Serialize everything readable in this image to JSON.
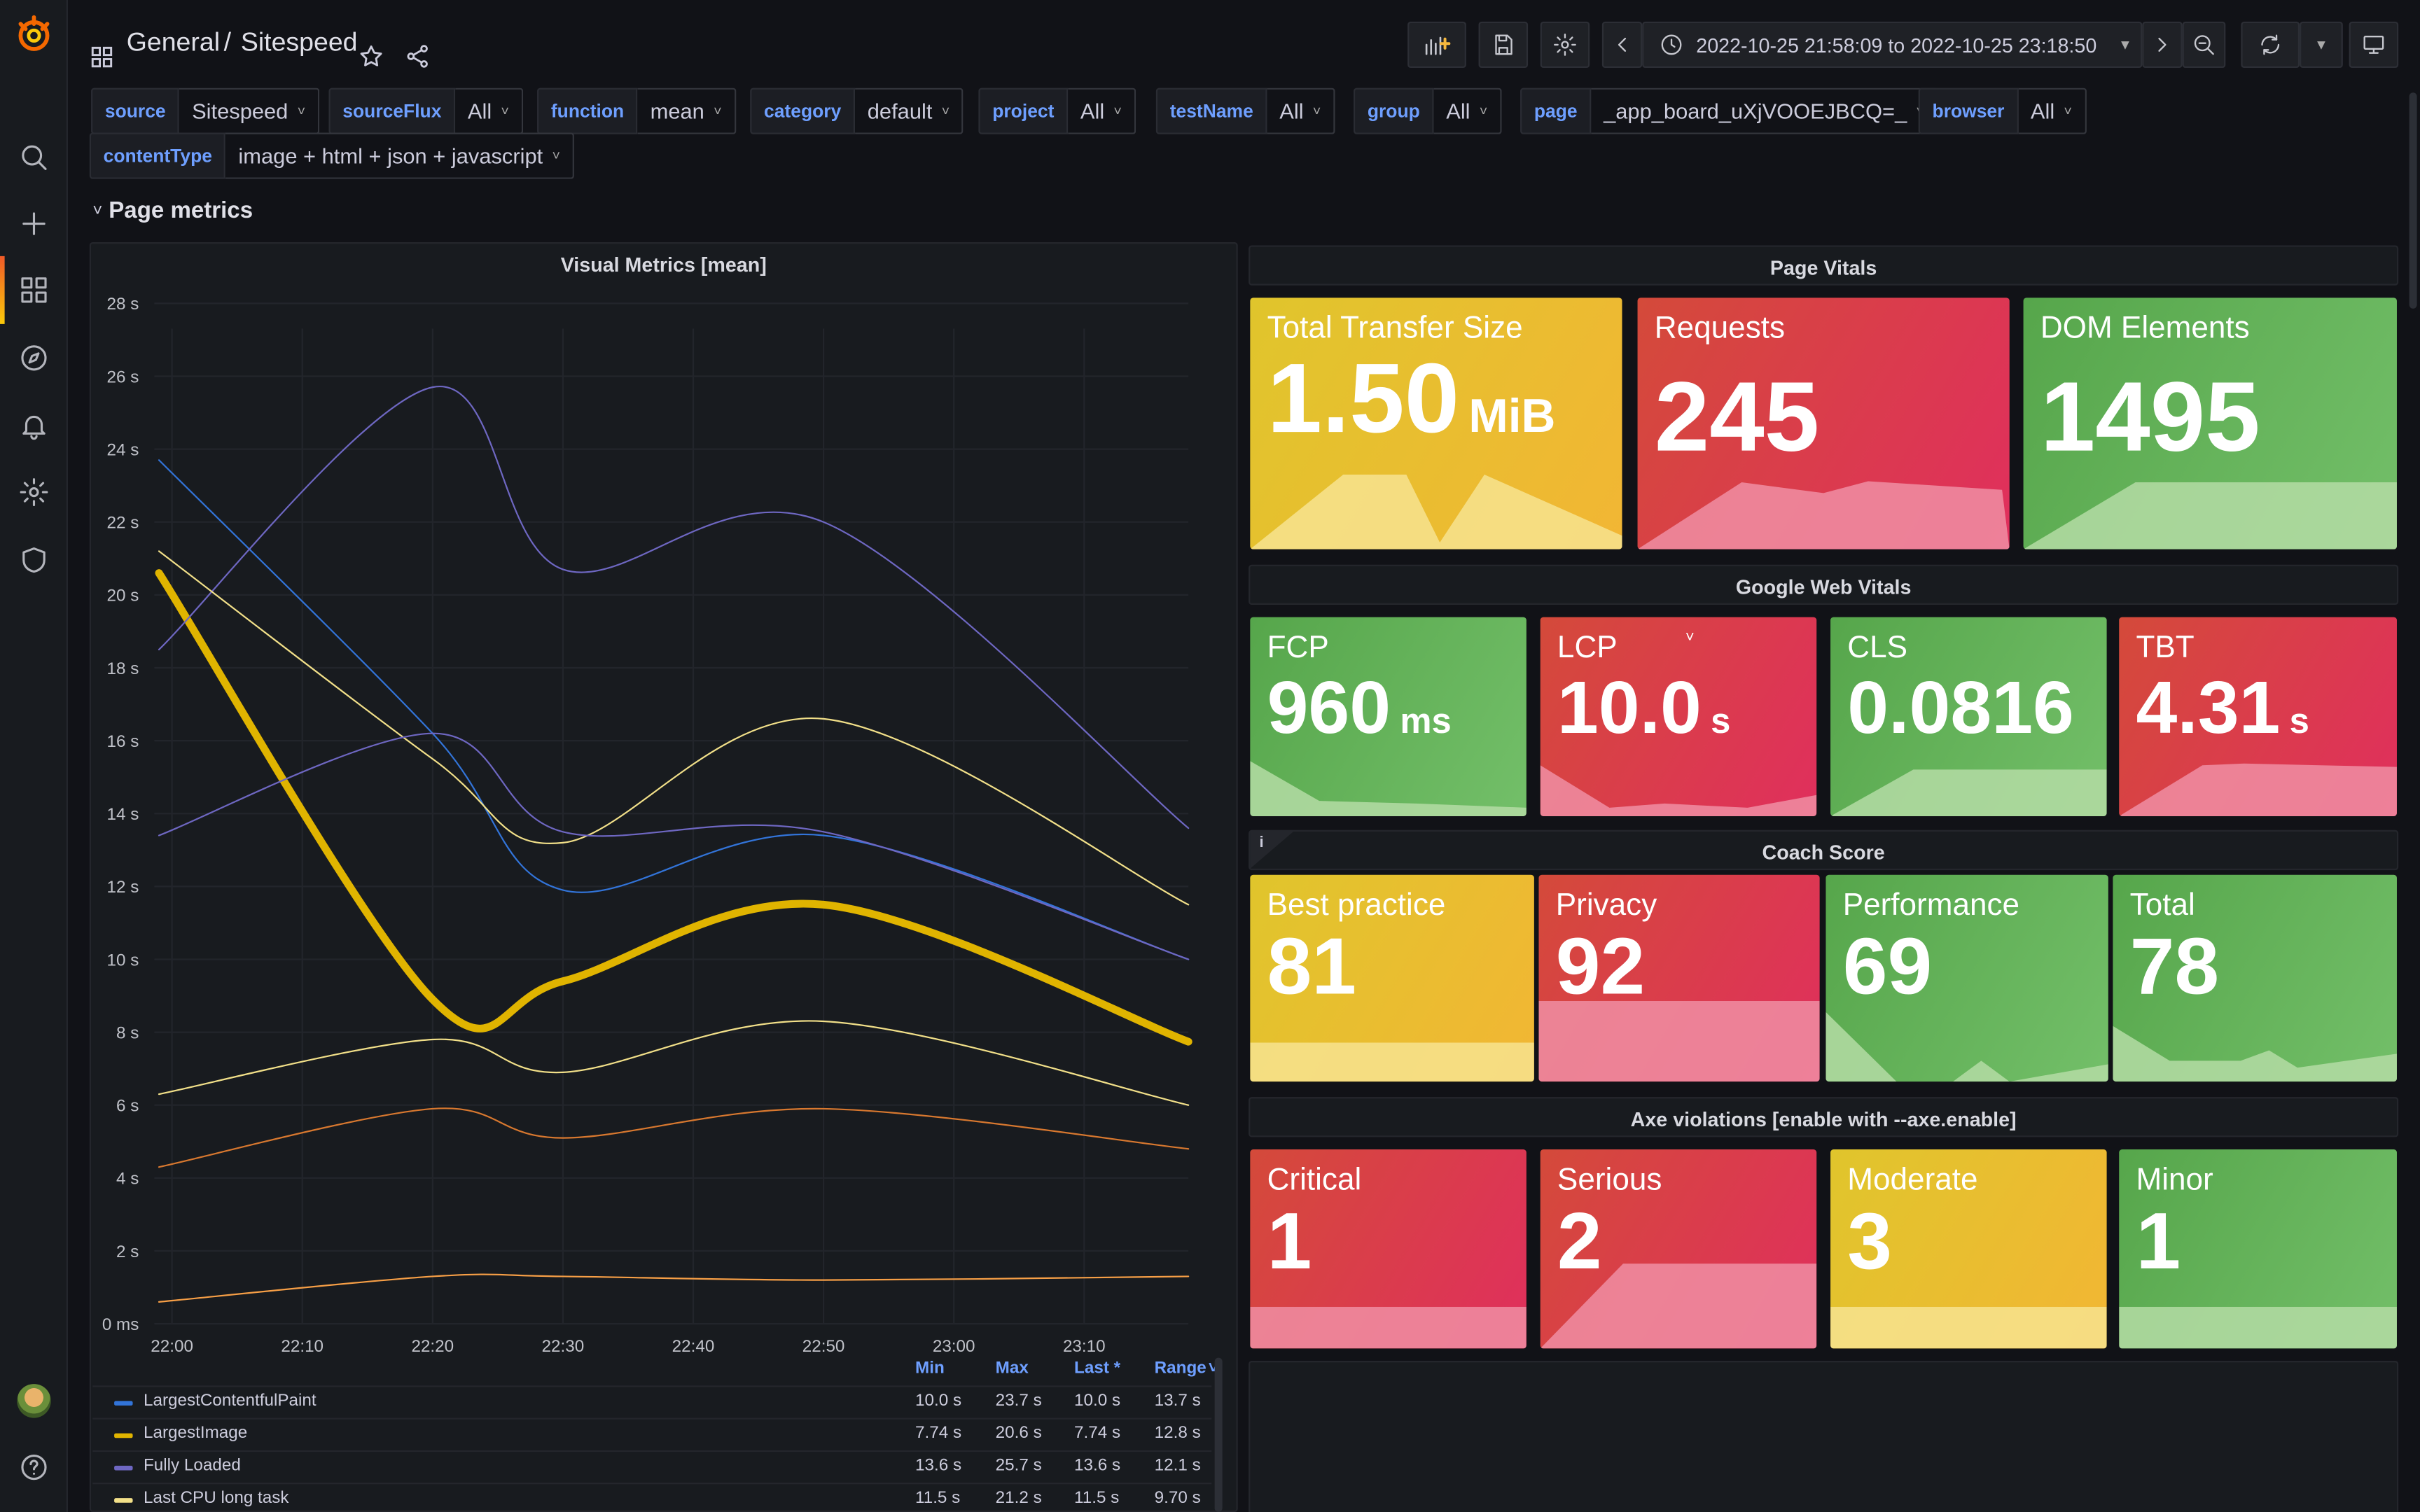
{
  "breadcrumb": {
    "folder": "General",
    "separator": "/",
    "dashboard": "Sitespeed"
  },
  "timepicker": {
    "range": "2022-10-25 21:58:09 to 2022-10-25 23:18:50"
  },
  "variables": [
    {
      "label": "source",
      "value": "Sitespeed"
    },
    {
      "label": "sourceFlux",
      "value": "All"
    },
    {
      "label": "function",
      "value": "mean"
    },
    {
      "label": "category",
      "value": "default"
    },
    {
      "label": "project",
      "value": "All"
    },
    {
      "label": "testName",
      "value": "All"
    },
    {
      "label": "group",
      "value": "All"
    },
    {
      "label": "page",
      "value": "_app_board_uXjVOOEJBCQ=_"
    },
    {
      "label": "browser",
      "value": "All"
    },
    {
      "label": "contentType",
      "value": "image + html + json + javascript"
    }
  ],
  "row": {
    "title": "Page metrics",
    "chevron": "˅"
  },
  "vitals_header": "Page Vitals",
  "page_vitals": [
    {
      "label": "Total Transfer Size",
      "value": "1.50",
      "unit": "MiB",
      "color": "yellow"
    },
    {
      "label": "Requests",
      "value": "245",
      "unit": "",
      "color": "red"
    },
    {
      "label": "DOM Elements",
      "value": "1495",
      "unit": "",
      "color": "green"
    }
  ],
  "web_vitals_header": "Google Web Vitals",
  "web_vitals": [
    {
      "label": "FCP",
      "value": "960",
      "unit": "ms",
      "color": "green"
    },
    {
      "label": "LCP",
      "value": "10.0",
      "unit": "s",
      "color": "red"
    },
    {
      "label": "CLS",
      "value": "0.0816",
      "unit": "",
      "color": "green"
    },
    {
      "label": "TBT",
      "value": "4.31",
      "unit": "s",
      "color": "red"
    }
  ],
  "coach_header": "Coach Score",
  "coach_info": "i",
  "coach": [
    {
      "label": "Best practice",
      "value": "81",
      "color": "yellow"
    },
    {
      "label": "Privacy",
      "value": "92",
      "color": "red"
    },
    {
      "label": "Performance",
      "value": "69",
      "color": "green"
    },
    {
      "label": "Total",
      "value": "78",
      "color": "green"
    }
  ],
  "axe_header": "Axe violations [enable with --axe.enable]",
  "axe": [
    {
      "label": "Critical",
      "value": "1",
      "color": "red"
    },
    {
      "label": "Serious",
      "value": "2",
      "color": "red"
    },
    {
      "label": "Moderate",
      "value": "3",
      "color": "yellow"
    },
    {
      "label": "Minor",
      "value": "1",
      "color": "green"
    }
  ],
  "legend": {
    "headers": {
      "min": "Min",
      "max": "Max",
      "last": "Last *",
      "range": "Range"
    },
    "rows": [
      {
        "name": "LargestContentfulPaint",
        "min": "10.0 s",
        "max": "23.7 s",
        "last": "10.0 s",
        "range": "13.7 s"
      },
      {
        "name": "LargestImage",
        "min": "7.74 s",
        "max": "20.6 s",
        "last": "7.74 s",
        "range": "12.8 s"
      },
      {
        "name": "Fully Loaded",
        "min": "13.6 s",
        "max": "25.7 s",
        "last": "13.6 s",
        "range": "12.1 s"
      },
      {
        "name": "Last CPU long task",
        "min": "11.5 s",
        "max": "21.2 s",
        "last": "11.5 s",
        "range": "9.70 s"
      }
    ]
  },
  "colors": {
    "blue": "#3274d9",
    "yellow": "#e0b400",
    "purple": "#6e67c2",
    "lightyellow": "#f2e089",
    "orange": "#d8782f"
  },
  "chart_data": {
    "type": "line",
    "title": "Visual Metrics [mean]",
    "xlabel": "",
    "ylabel": "",
    "x": [
      "21:59",
      "22:20",
      "22:30",
      "22:50",
      "23:18"
    ],
    "x_ticks": [
      "22:00",
      "22:10",
      "22:20",
      "22:30",
      "22:40",
      "22:50",
      "23:00",
      "23:10"
    ],
    "y_ticks": [
      "0 ms",
      "2 s",
      "4 s",
      "6 s",
      "8 s",
      "10 s",
      "12 s",
      "14 s",
      "16 s",
      "18 s",
      "20 s",
      "22 s",
      "24 s",
      "26 s",
      "28 s"
    ],
    "ylim": [
      0,
      28
    ],
    "grid": true,
    "legend_position": "bottom",
    "series": [
      {
        "name": "LargestContentfulPaint",
        "color": "#3274d9",
        "width": 1,
        "values": [
          23.7,
          16.2,
          11.9,
          13.4,
          10.0
        ]
      },
      {
        "name": "LargestImage",
        "color": "#e0b400",
        "width": 5,
        "values": [
          20.6,
          8.9,
          9.4,
          11.5,
          7.74
        ]
      },
      {
        "name": "Fully Loaded",
        "color": "#6e67c2",
        "width": 1,
        "values": [
          18.5,
          25.7,
          20.7,
          22.0,
          13.6
        ]
      },
      {
        "name": "Last CPU long task",
        "color": "#f2e089",
        "width": 1,
        "values": [
          21.2,
          15.5,
          13.2,
          16.6,
          11.5
        ]
      },
      {
        "color": "#6e67c2",
        "width": 1,
        "values": [
          13.4,
          16.2,
          13.5,
          13.5,
          10.0
        ]
      },
      {
        "color": "#f2e089",
        "width": 1,
        "values": [
          6.3,
          7.8,
          6.9,
          8.3,
          6.0
        ]
      },
      {
        "color": "#d8782f",
        "width": 1,
        "values": [
          4.3,
          5.9,
          5.1,
          5.9,
          4.8
        ]
      },
      {
        "color": "#f79f46",
        "width": 1,
        "values": [
          0.6,
          1.3,
          1.3,
          1.2,
          1.3
        ]
      }
    ]
  }
}
